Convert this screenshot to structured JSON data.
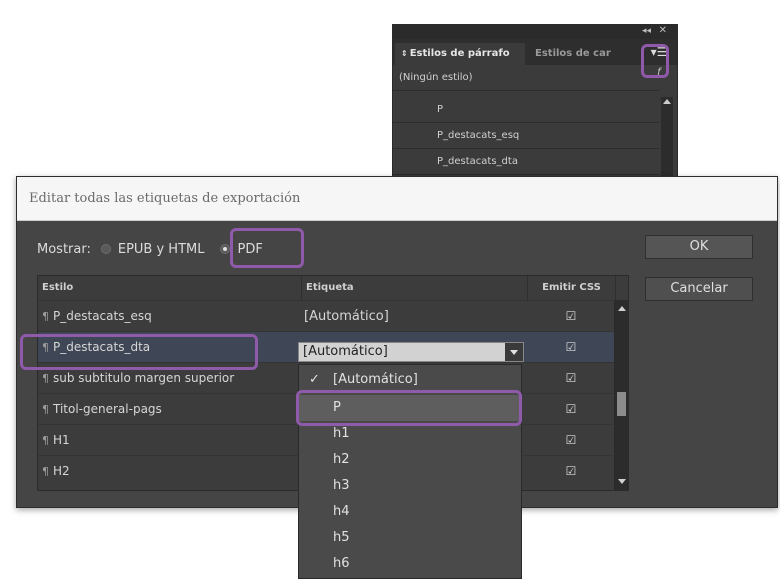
{
  "panel": {
    "tab_active": "Estilos de párrafo",
    "tab_inactive": "Estilos de car",
    "items": [
      "(Ningún estilo)",
      "P",
      "P_destacats_esq",
      "P_destacats_dta"
    ],
    "icons": [
      "collapse-arrows-icon",
      "close-icon",
      "panel-menu-icon",
      "new-style-icon"
    ]
  },
  "dialog": {
    "title": "Editar todas las etiquetas de exportación",
    "show_label": "Mostrar:",
    "option_epub": "EPUB y HTML",
    "option_pdf": "PDF",
    "selected_option": "PDF",
    "ok": "OK",
    "cancel": "Cancelar"
  },
  "table": {
    "headers": [
      "Estilo",
      "Etiqueta",
      "Emitir CSS"
    ],
    "rows": [
      {
        "style": "P_destacats_esq",
        "tag": "[Automático]",
        "emit_css": true
      },
      {
        "style": "P_destacats_dta",
        "tag": "[Automático]",
        "emit_css": true
      },
      {
        "style": "sub subtitulo margen superior",
        "tag": "",
        "emit_css": true
      },
      {
        "style": "Titol-general-pags",
        "tag": "",
        "emit_css": true
      },
      {
        "style": "H1",
        "tag": "",
        "emit_css": true
      },
      {
        "style": "H2",
        "tag": "",
        "emit_css": true
      }
    ],
    "check_glyph": "☑",
    "para_glyph": "¶"
  },
  "dropdown": {
    "current_value": "[Automático]",
    "options": [
      "[Automático]",
      "P",
      "h1",
      "h2",
      "h3",
      "h4",
      "h5",
      "h6"
    ],
    "checked_option": "[Automático]",
    "highlighted_option": "P",
    "checkmark": "✓"
  },
  "colors": {
    "highlight": "#8e5aa9",
    "dialog_bg": "#454545",
    "panel_bg": "#3b3b3b"
  }
}
